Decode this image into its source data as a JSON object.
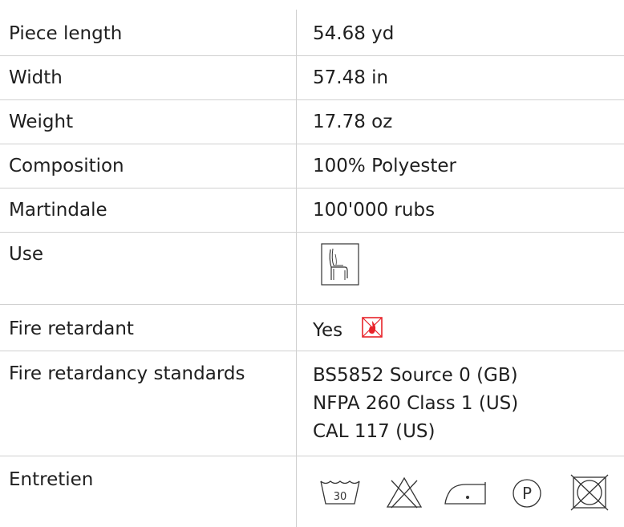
{
  "rows": [
    {
      "label": "Piece length",
      "value": "54.68 yd"
    },
    {
      "label": "Width",
      "value": "57.48 in"
    },
    {
      "label": "Weight",
      "value": "17.78 oz"
    },
    {
      "label": "Composition",
      "value": "100% Polyester"
    },
    {
      "label": "Martindale",
      "value": "100'000 rubs"
    },
    {
      "label": "Use",
      "icon": "upholstery-chair-icon"
    },
    {
      "label": "Fire retardant",
      "value": "Yes",
      "icon": "flame-warning-icon",
      "icon_color": "#e8232a"
    },
    {
      "label": "Fire retardancy standards",
      "values": [
        "BS5852 Source 0 (GB)",
        "NFPA 260 Class 1 (US)",
        "CAL 117 (US)"
      ]
    },
    {
      "label": "Entretien",
      "care_icons": [
        {
          "icon": "wash-30-icon",
          "text": "30"
        },
        {
          "icon": "no-bleach-icon"
        },
        {
          "icon": "iron-low-heat-icon"
        },
        {
          "icon": "dry-clean-p-icon",
          "text": "P"
        },
        {
          "icon": "no-tumble-dry-icon"
        }
      ]
    }
  ],
  "colors": {
    "text": "#1f1f1f",
    "divider": "#d0d0d0",
    "fire_icon": "#e8232a"
  }
}
